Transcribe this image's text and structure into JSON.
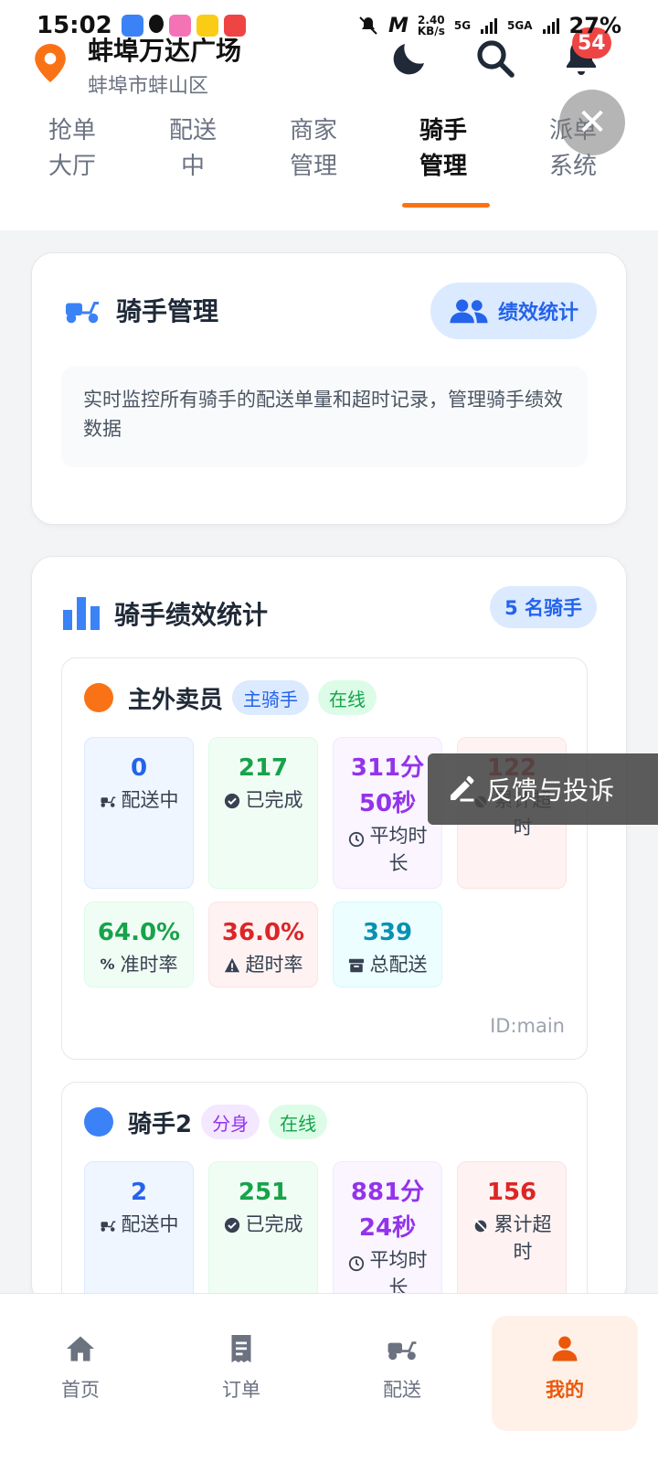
{
  "status_bar": {
    "time": "15:02",
    "net_speed": "2.40\nKB/s",
    "signal1": "5G",
    "signal2": "5GA",
    "battery": "27%"
  },
  "header": {
    "location_title": "蚌埠万达广场",
    "location_sub": "蚌埠市蚌山区",
    "notification_count": "54"
  },
  "tabs": [
    {
      "label": "抢单\n大厅"
    },
    {
      "label": "配送\n中"
    },
    {
      "label": "商家\n管理"
    },
    {
      "label": "骑手\n管理"
    },
    {
      "label": "派单\n系统"
    }
  ],
  "rider_management": {
    "title": "骑手管理",
    "button": "绩效统计",
    "description": "实时监控所有骑手的配送单量和超时记录，管理骑手绩效数据"
  },
  "stats_card": {
    "title": "骑手绩效统计",
    "count_label": "5 名骑手"
  },
  "riders": [
    {
      "name": "主外卖员",
      "role_tag": "主骑手",
      "status_tag": "在线",
      "dot_color": "#f97316",
      "stats": {
        "delivering": "0",
        "delivering_label": "配送中",
        "completed": "217",
        "completed_label": "已完成",
        "avg_time": "311分\n50秒",
        "avg_time_label": "平均时\n长",
        "timeout_total": "122",
        "timeout_total_label": "累计超\n时",
        "on_time_rate": "64.0%",
        "on_time_rate_label": "准时率",
        "timeout_rate": "36.0%",
        "timeout_rate_label": "超时率",
        "total": "339",
        "total_label": "总配送"
      },
      "id": "ID:main"
    },
    {
      "name": "骑手2",
      "role_tag": "分身",
      "status_tag": "在线",
      "dot_color": "#3b82f6",
      "stats": {
        "delivering": "2",
        "delivering_label": "配送中",
        "completed": "251",
        "completed_label": "已完成",
        "avg_time": "881分\n24秒",
        "avg_time_label": "平均时\n长",
        "timeout_total": "156",
        "timeout_total_label": "累计超\n时"
      }
    }
  ],
  "feedback": "反馈与投诉",
  "bottom_nav": [
    {
      "label": "首页"
    },
    {
      "label": "订单"
    },
    {
      "label": "配送"
    },
    {
      "label": "我的"
    }
  ],
  "colors": {
    "accent": "#f97316",
    "primary_blue": "#2563eb"
  }
}
